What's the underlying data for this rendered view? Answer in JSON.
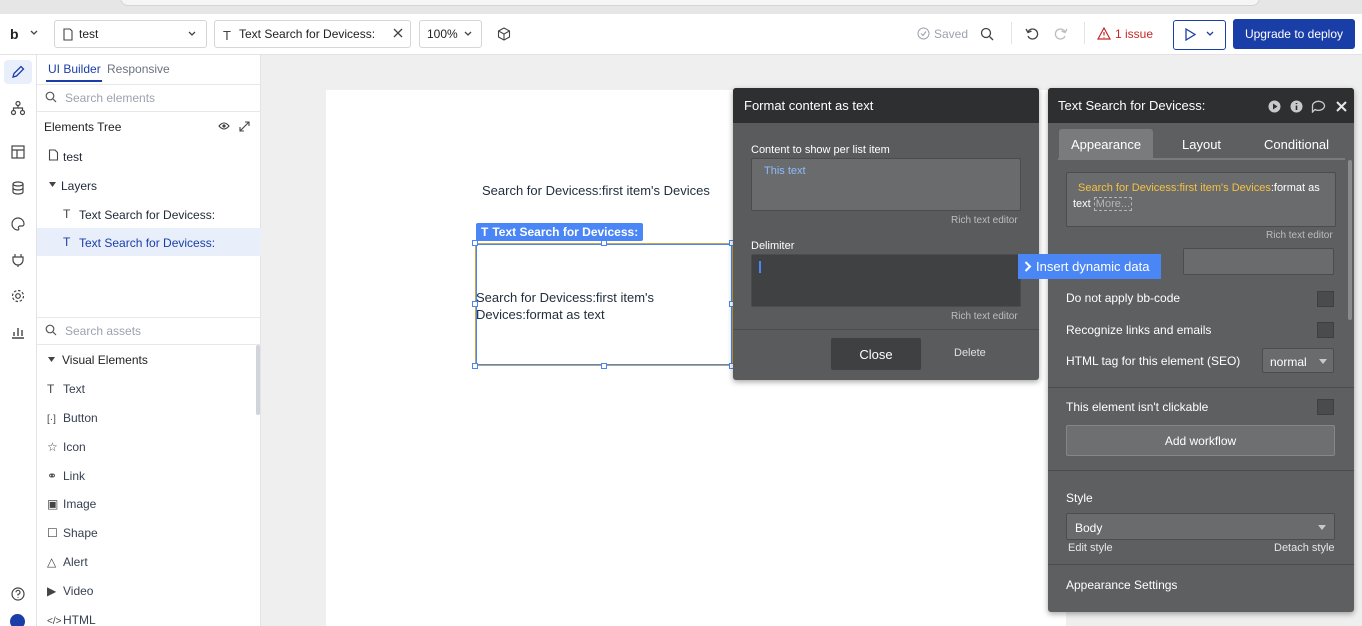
{
  "topbar": {
    "logo": "b",
    "page_select": "test",
    "element_select": "Text Search for Devicess:",
    "zoom": "100%",
    "saved": "Saved",
    "issues": "1 issue",
    "deploy": "Upgrade to deploy"
  },
  "left_panel": {
    "tab_ui_builder": "UI Builder",
    "tab_responsive": "Responsive",
    "search_elements_placeholder": "Search elements",
    "elements_tree_title": "Elements Tree",
    "tree": {
      "page": "test",
      "layers": "Layers",
      "items": [
        "Text Search for Devicess:",
        "Text Search for Devicess:"
      ]
    },
    "search_assets_placeholder": "Search assets",
    "visual_elements_title": "Visual Elements",
    "visual_elements": [
      "Text",
      "Button",
      "Icon",
      "Link",
      "Image",
      "Shape",
      "Alert",
      "Video",
      "HTML"
    ]
  },
  "canvas": {
    "text1": "Search for Devicess:first item's Devices",
    "selected_label": "Text Search for Devicess:",
    "text2": "Search for Devicess:first item's Devices:format as text"
  },
  "format_popup": {
    "title": "Format content as text",
    "content_label": "Content to show per list item",
    "content_value": "This text",
    "rich_text_editor": "Rich text editor",
    "delimiter_label": "Delimiter",
    "delimiter_rte": "Rich text editor",
    "close": "Close",
    "delete": "Delete"
  },
  "insert_dynamic": "Insert dynamic data",
  "property_editor": {
    "title": "Text Search for Devicess:",
    "tabs": [
      "Appearance",
      "Layout",
      "Conditional"
    ],
    "expr_dynamic": "Search for Devicess:first item's Devices",
    "expr_static": ":format as text",
    "expr_more": "More...",
    "rich_text_editor": "Rich text editor",
    "do_not_apply_bb": "Do not apply bb-code",
    "recognize_links": "Recognize links and emails",
    "html_tag_label": "HTML tag for this element (SEO)",
    "html_tag_value": "normal",
    "not_clickable": "This element isn't clickable",
    "add_workflow": "Add workflow",
    "style_label": "Style",
    "style_value": "Body",
    "edit_style": "Edit style",
    "detach_style": "Detach style",
    "appearance_settings": "Appearance Settings"
  },
  "colors": {
    "accent_blue": "#1a3ea8",
    "selection_blue": "#4a86f5",
    "dynamic_yellow": "#f5c242",
    "issue_red": "#c62828"
  }
}
